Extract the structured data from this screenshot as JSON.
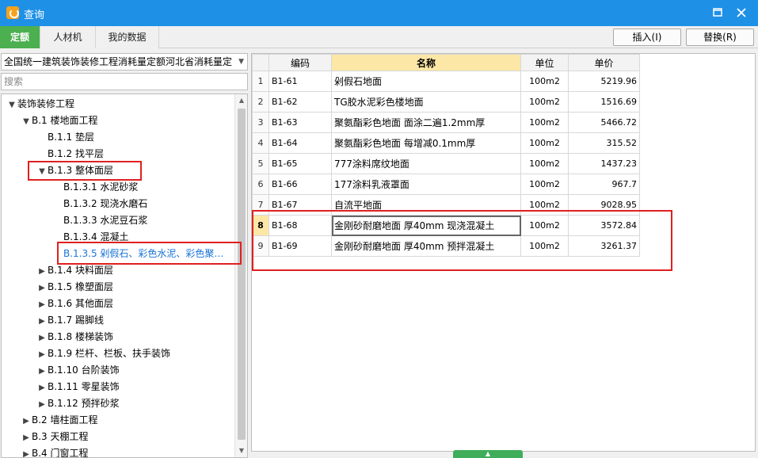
{
  "window": {
    "title": "查询",
    "minimize_icon": "minimize-icon",
    "close_icon": "close-icon"
  },
  "tabs": [
    {
      "label": "定额",
      "active": true
    },
    {
      "label": "人材机",
      "active": false
    },
    {
      "label": "我的数据",
      "active": false
    }
  ],
  "actions": {
    "insert_label": "插入(I)",
    "replace_label": "替换(R)"
  },
  "left": {
    "combo_value": "全国统一建筑装饰装修工程消耗量定额河北省消耗量定",
    "search_placeholder": "搜索",
    "tree": [
      {
        "label": "装饰装修工程",
        "toggle": "▼",
        "level": 0
      },
      {
        "label": "B.1  楼地面工程",
        "toggle": "▼",
        "level": 1
      },
      {
        "label": "B.1.1  垫层",
        "toggle": "",
        "level": 2
      },
      {
        "label": "B.1.2  找平层",
        "toggle": "",
        "level": 2
      },
      {
        "label": "B.1.3  整体面层",
        "toggle": "▼",
        "level": 2
      },
      {
        "label": "B.1.3.1  水泥砂浆",
        "toggle": "",
        "level": 3
      },
      {
        "label": "B.1.3.2  现浇水磨石",
        "toggle": "",
        "level": 3
      },
      {
        "label": "B.1.3.3  水泥豆石浆",
        "toggle": "",
        "level": 3
      },
      {
        "label": "B.1.3.4  混凝土",
        "toggle": "",
        "level": 3
      },
      {
        "label": "B.1.3.5  剁假石、彩色水泥、彩色聚…",
        "toggle": "",
        "level": 3,
        "selected": true
      },
      {
        "label": "B.1.4  块料面层",
        "toggle": "▶",
        "level": 2
      },
      {
        "label": "B.1.5  橡塑面层",
        "toggle": "▶",
        "level": 2
      },
      {
        "label": "B.1.6  其他面层",
        "toggle": "▶",
        "level": 2
      },
      {
        "label": "B.1.7  踢脚线",
        "toggle": "▶",
        "level": 2
      },
      {
        "label": "B.1.8  楼梯装饰",
        "toggle": "▶",
        "level": 2
      },
      {
        "label": "B.1.9  栏杆、栏板、扶手装饰",
        "toggle": "▶",
        "level": 2
      },
      {
        "label": "B.1.10  台阶装饰",
        "toggle": "▶",
        "level": 2
      },
      {
        "label": "B.1.11  零星装饰",
        "toggle": "▶",
        "level": 2
      },
      {
        "label": "B.1.12  预拌砂浆",
        "toggle": "▶",
        "level": 2
      },
      {
        "label": "B.2  墙柱面工程",
        "toggle": "▶",
        "level": 1
      },
      {
        "label": "B.3  天棚工程",
        "toggle": "▶",
        "level": 1
      },
      {
        "label": "B.4  门窗工程",
        "toggle": "▶",
        "level": 1
      }
    ]
  },
  "grid": {
    "headers": [
      "",
      "编码",
      "名称",
      "单位",
      "单价"
    ],
    "rows": [
      {
        "num": "1",
        "code": "B1-61",
        "name": "剁假石地面",
        "unit": "100m2",
        "price": "5219.96"
      },
      {
        "num": "2",
        "code": "B1-62",
        "name": "TG胶水泥彩色楼地面",
        "unit": "100m2",
        "price": "1516.69"
      },
      {
        "num": "3",
        "code": "B1-63",
        "name": "聚氨酯彩色地面 面涂二遍1.2mm厚",
        "unit": "100m2",
        "price": "5466.72"
      },
      {
        "num": "4",
        "code": "B1-64",
        "name": "聚氨酯彩色地面 每增减0.1mm厚",
        "unit": "100m2",
        "price": "315.52"
      },
      {
        "num": "5",
        "code": "B1-65",
        "name": "777涂料席纹地面",
        "unit": "100m2",
        "price": "1437.23"
      },
      {
        "num": "6",
        "code": "B1-66",
        "name": "177涂料乳液罩面",
        "unit": "100m2",
        "price": "967.7"
      },
      {
        "num": "7",
        "code": "B1-67",
        "name": "自流平地面",
        "unit": "100m2",
        "price": "9028.95"
      },
      {
        "num": "8",
        "code": "B1-68",
        "name": "金刚砂耐磨地面 厚40mm 现浇混凝土",
        "unit": "100m2",
        "price": "3572.84",
        "current": true
      },
      {
        "num": "9",
        "code": "B1-69",
        "name": "金刚砂耐磨地面 厚40mm 预拌混凝土",
        "unit": "100m2",
        "price": "3261.37"
      }
    ]
  },
  "colors": {
    "titlebar": "#1e90e6",
    "active_tab": "#4caf50",
    "highlight": "#fde7a6",
    "annotation": "#e02020",
    "selected_text": "#1a74d6"
  }
}
